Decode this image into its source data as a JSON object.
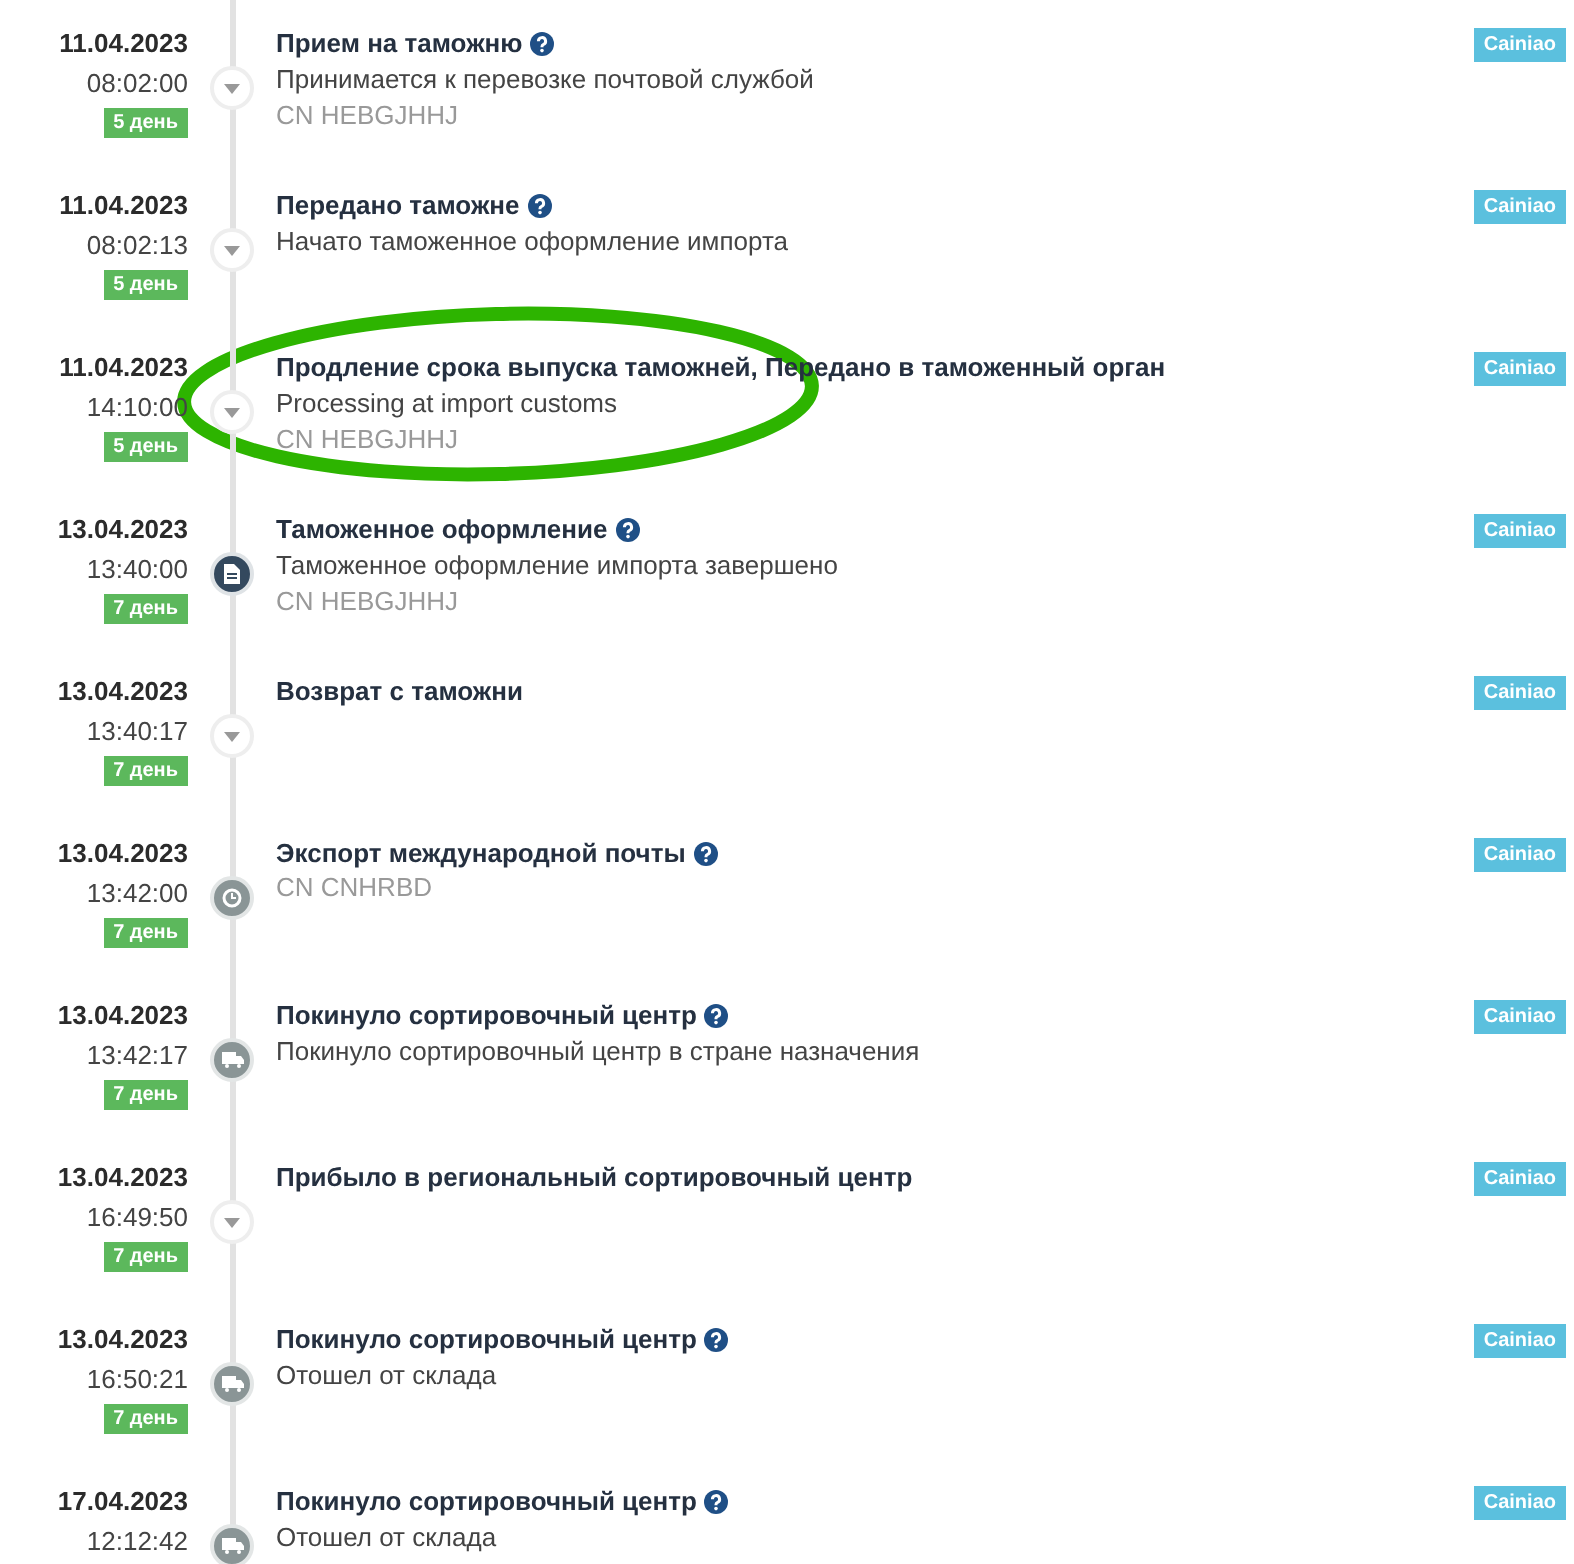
{
  "events": [
    {
      "date": "11.04.2023",
      "time": "08:02:00",
      "days": "5 день",
      "title": "Прием на таможню",
      "help": true,
      "description": "Принимается к перевозке почтовой службой",
      "code": "CN HEBGJHHJ",
      "kind": "caret",
      "carrier": "Cainiao"
    },
    {
      "date": "11.04.2023",
      "time": "08:02:13",
      "days": "5 день",
      "title": "Передано таможне",
      "help": true,
      "description": "Начато таможенное оформление импорта",
      "kind": "caret",
      "carrier": "Cainiao"
    },
    {
      "date": "11.04.2023",
      "time": "14:10:00",
      "days": "5 день",
      "title": "Продление срока выпуска таможней, Передано в таможенный орган",
      "help": false,
      "description": "Processing at import customs",
      "code": "CN HEBGJHHJ",
      "kind": "caret",
      "carrier": "Cainiao"
    },
    {
      "date": "13.04.2023",
      "time": "13:40:00",
      "days": "7 день",
      "title": "Таможенное оформление",
      "help": true,
      "description": "Таможенное оформление импорта завершено",
      "code": "CN HEBGJHHJ",
      "kind": "document",
      "carrier": "Cainiao"
    },
    {
      "date": "13.04.2023",
      "time": "13:40:17",
      "days": "7 день",
      "title": "Возврат с таможни",
      "help": false,
      "kind": "caret",
      "carrier": "Cainiao"
    },
    {
      "date": "13.04.2023",
      "time": "13:42:00",
      "days": "7 день",
      "title": "Экспорт международной почты",
      "help": true,
      "code": "CN CNHRBD",
      "kind": "clock",
      "carrier": "Cainiao"
    },
    {
      "date": "13.04.2023",
      "time": "13:42:17",
      "days": "7 день",
      "title": "Покинуло сортировочный центр",
      "help": true,
      "description": "Покинуло сортировочный центр в стране назначения",
      "kind": "truck",
      "carrier": "Cainiao"
    },
    {
      "date": "13.04.2023",
      "time": "16:49:50",
      "days": "7 день",
      "title": "Прибыло в региональный сортировочный центр",
      "help": false,
      "kind": "caret",
      "carrier": "Cainiao"
    },
    {
      "date": "13.04.2023",
      "time": "16:50:21",
      "days": "7 день",
      "title": "Покинуло сортировочный центр",
      "help": true,
      "description": "Отошел от склада",
      "kind": "truck",
      "carrier": "Cainiao"
    },
    {
      "date": "17.04.2023",
      "time": "12:12:42",
      "title": "Покинуло сортировочный центр",
      "help": true,
      "description": "Отошел от склада",
      "kind": "truck",
      "carrier": "Cainiao"
    }
  ],
  "annotation": {
    "kind": "ellipse",
    "color": "#2db400"
  }
}
